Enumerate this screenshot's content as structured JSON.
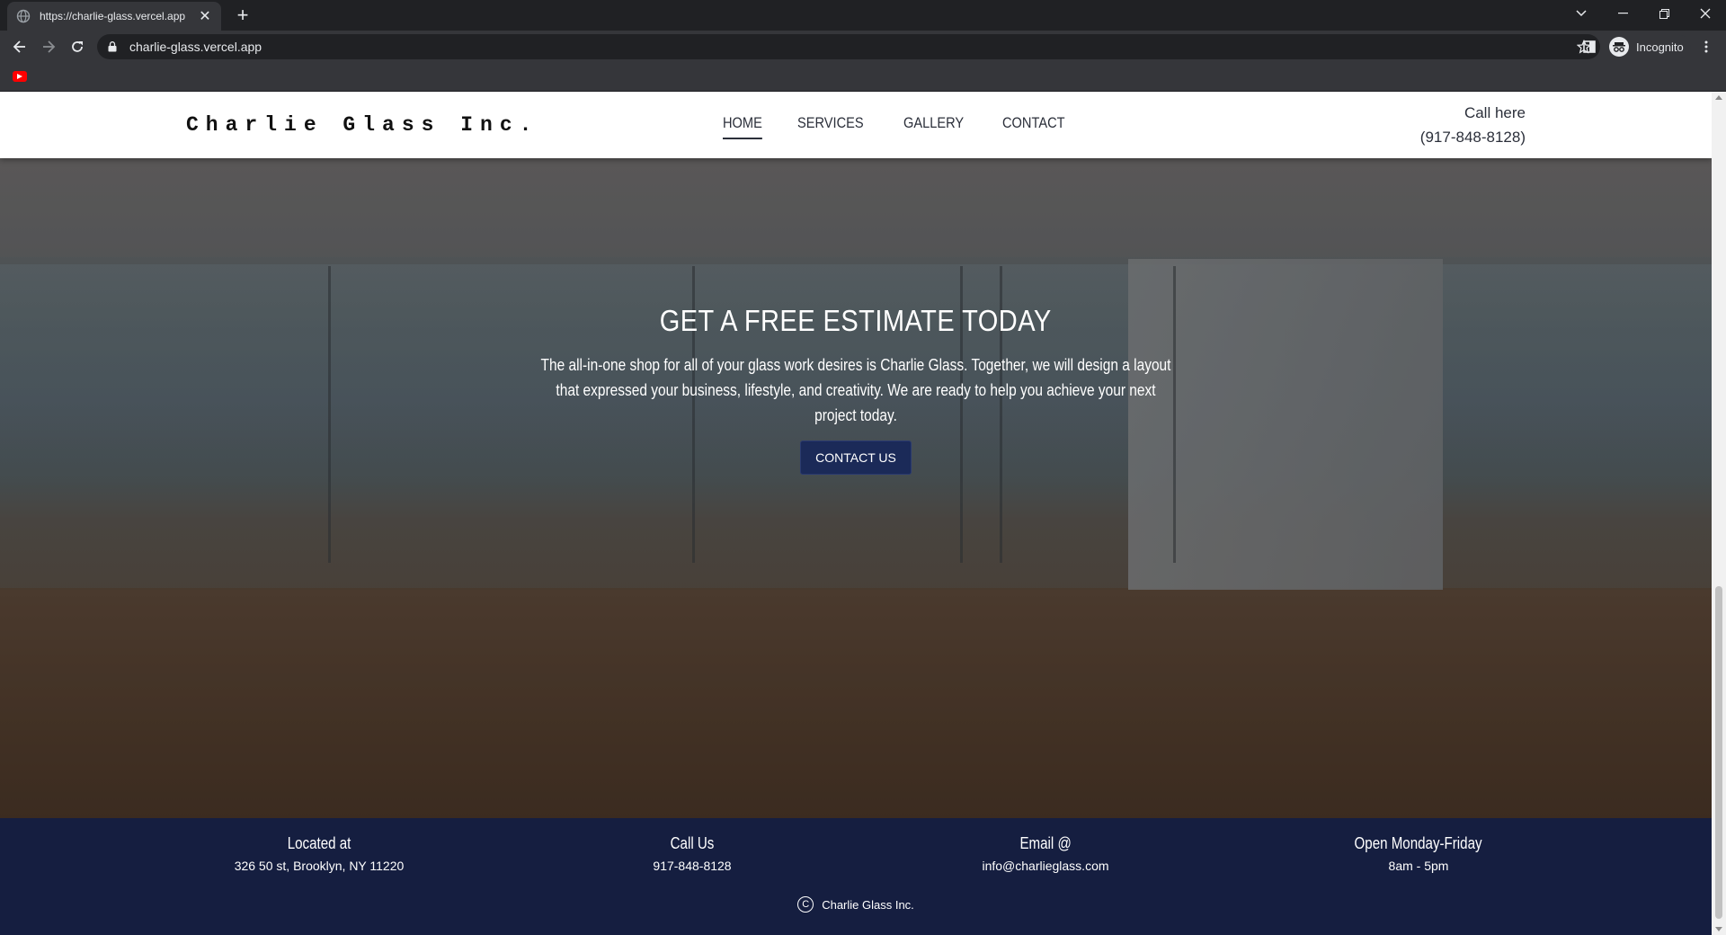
{
  "browser": {
    "tab_title": "https://charlie-glass.vercel.app",
    "url": "charlie-glass.vercel.app",
    "profile_label": "Incognito"
  },
  "site": {
    "logo": "Charlie Glass Inc.",
    "nav": [
      {
        "label": "HOME",
        "active": true
      },
      {
        "label": "SERVICES",
        "active": false
      },
      {
        "label": "GALLERY",
        "active": false
      },
      {
        "label": "CONTACT",
        "active": false
      }
    ],
    "call_label": "Call here",
    "call_number": "(917-848-8128)"
  },
  "hero": {
    "title": "GET A FREE ESTIMATE TODAY",
    "text": "The all-in-one shop for all of your glass work desires is Charlie Glass. Together, we will design a layout that expressed your business, lifestyle, and creativity. We are ready to help you achieve your next project today.",
    "cta": "CONTACT US"
  },
  "footer": {
    "columns": [
      {
        "heading": "Located at",
        "value": "326 50 st, Brooklyn, NY 11220"
      },
      {
        "heading": "Call Us",
        "value": "917-848-8128"
      },
      {
        "heading": "Email @",
        "value": "info@charlieglass.com"
      },
      {
        "heading": "Open Monday-Friday",
        "value": "8am - 5pm"
      }
    ],
    "copyright": "Charlie Glass Inc."
  },
  "colors": {
    "footer_bg": "#151e40",
    "cta_bg": "#1b2a58",
    "chrome_bg": "#202124",
    "toolbar_bg": "#35363a"
  }
}
